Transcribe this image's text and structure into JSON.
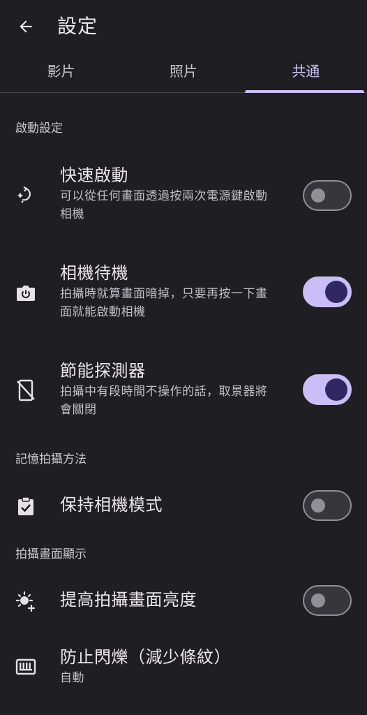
{
  "header": {
    "title": "設定",
    "back_icon": "arrow-back-icon"
  },
  "tabs": [
    {
      "label": "影片",
      "active": false
    },
    {
      "label": "照片",
      "active": false
    },
    {
      "label": "共通",
      "active": true
    }
  ],
  "sections": [
    {
      "header": "啟動設定",
      "items": [
        {
          "icon": "quick-launch-sparkle-icon",
          "title": "快速啟動",
          "subtitle_lines": [
            "可以從任何畫面透過按兩次電源鍵啟動",
            "相機"
          ],
          "toggle": false
        },
        {
          "icon": "camera-power-icon",
          "title": "相機待機",
          "subtitle_lines": [
            "拍攝時就算畫面暗掉，只要再按一下畫",
            "面就能啟動相機"
          ],
          "toggle": true
        },
        {
          "icon": "phone-off-icon",
          "title": "節能探測器",
          "subtitle_lines": [
            "拍攝中有段時間不操作的話，取景器將",
            "會關閉"
          ],
          "toggle": true
        }
      ]
    },
    {
      "header": "記憶拍攝方法",
      "items": [
        {
          "icon": "clipboard-check-icon",
          "title": "保持相機模式",
          "toggle": false
        }
      ]
    },
    {
      "header": "拍攝畫面顯示",
      "items": [
        {
          "icon": "brightness-plus-icon",
          "title": "提高拍攝畫面亮度",
          "toggle": false
        },
        {
          "icon": "flicker-icon",
          "title": "防止閃爍（減少條紋）",
          "subtitle": "自動"
        }
      ]
    }
  ],
  "colors": {
    "background": "#1f1e22",
    "accent": "#cbbdf5",
    "toggle_knob_on": "#2f2863",
    "toggle_off_outline": "#938f99"
  }
}
